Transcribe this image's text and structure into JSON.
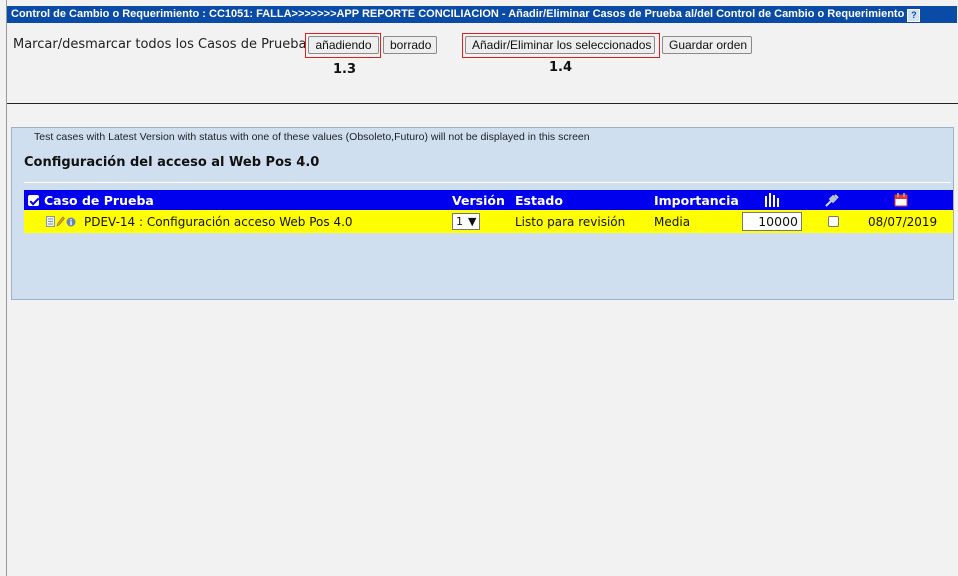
{
  "title_bar": {
    "text": "Control de Cambio o Requerimiento : CC1051: FALLA>>>>>>>APP REPORTE CONCILIACION - Añadir/Eliminar Casos de Prueba al/del Control de Cambio o Requerimiento",
    "help_icon": "?"
  },
  "toolbar": {
    "mark_label": "Marcar/desmarcar todos los Casos de Prueba para",
    "adding_button": "añadiendo",
    "removal_button": "borrado",
    "add_remove_button": "Añadir/Eliminar los seleccionados",
    "save_order_button": "Guardar orden",
    "step_a": "1.3",
    "step_b": "1.4"
  },
  "panel": {
    "notice": "Test cases with Latest Version with status with one of these values (Obsoleto,Futuro) will not be displayed in this screen",
    "suite_title": "Configuración del acceso al Web Pos 4.0"
  },
  "table": {
    "headers": {
      "test_case": "Caso de Prueba",
      "version": "Versión",
      "status": "Estado",
      "importance": "Importancia",
      "order_icon": "bar-chart-icon",
      "link_icon": "plug-icon",
      "date_icon": "calendar-icon"
    },
    "rows": [
      {
        "test_case": "PDEV-14 : Configuración acceso Web Pos 4.0",
        "version": "1",
        "status": "Listo para revisión",
        "importance": "Media",
        "order": "10000",
        "linked": false,
        "date": "08/07/2019"
      }
    ]
  },
  "colors": {
    "title_bar": "#0a4ba8",
    "header": "#0000ee",
    "row": "#ffff00",
    "panel": "#cfdff0",
    "highlight_box": "#e02020"
  }
}
